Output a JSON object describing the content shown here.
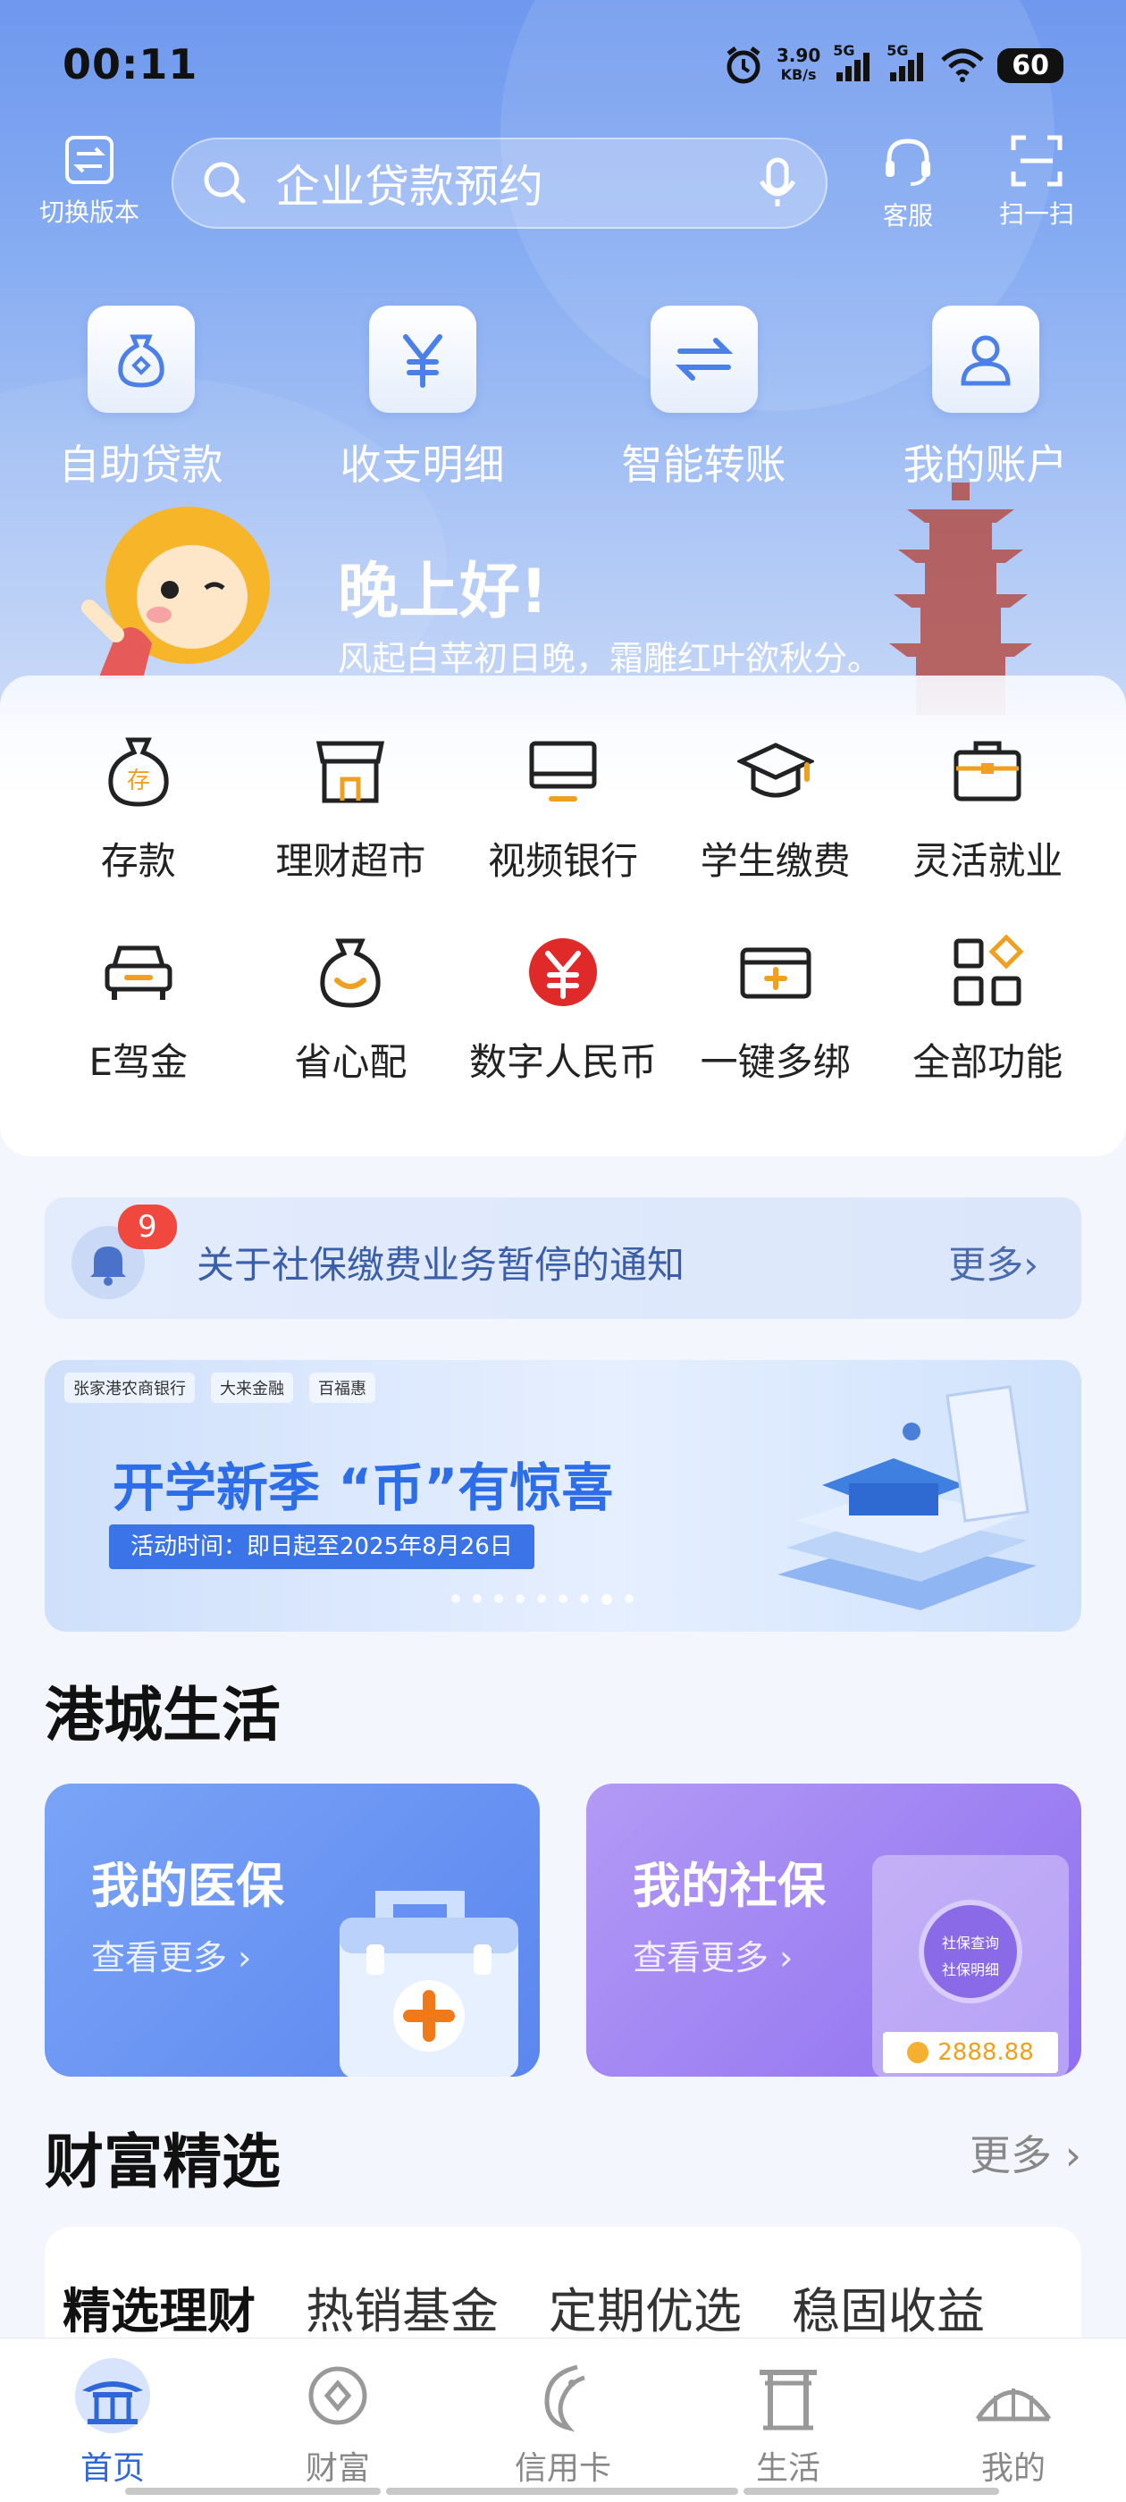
{
  "status_bar": {
    "time": "00:11",
    "speed_value": "3.90",
    "speed_unit": "KB/s",
    "net1": "5G",
    "net2": "5G",
    "battery": "60"
  },
  "top_bar": {
    "switch_version": "切换版本",
    "search_placeholder": "企业贷款预约",
    "service": "客服",
    "scan": "扫一扫"
  },
  "quick_actions": [
    {
      "label": "自助贷款",
      "icon": "money-bag-icon"
    },
    {
      "label": "收支明细",
      "icon": "yuan-icon"
    },
    {
      "label": "智能转账",
      "icon": "transfer-icon"
    },
    {
      "label": "我的账户",
      "icon": "user-icon"
    }
  ],
  "greeting": {
    "title": "晚上好!",
    "poem": "风起白苹初日晚，霜雕红叶欲秋分。"
  },
  "functions": [
    {
      "label": "存款",
      "icon": "deposit-bag-icon"
    },
    {
      "label": "理财超市",
      "icon": "store-icon"
    },
    {
      "label": "视频银行",
      "icon": "monitor-icon"
    },
    {
      "label": "学生缴费",
      "icon": "graduation-cap-icon"
    },
    {
      "label": "灵活就业",
      "icon": "briefcase-icon"
    },
    {
      "label": "E驾金",
      "icon": "car-icon"
    },
    {
      "label": "省心配",
      "icon": "smile-bag-icon"
    },
    {
      "label": "数字人民币",
      "icon": "digital-rmb-icon"
    },
    {
      "label": "一键多绑",
      "icon": "card-plus-icon"
    },
    {
      "label": "全部功能",
      "icon": "grid-icon"
    }
  ],
  "notice": {
    "badge": "9",
    "text": "关于社保缴费业务暂停的通知",
    "more": "更多›"
  },
  "banner": {
    "brand1": "张家港农商银行",
    "brand2": "大来金融",
    "brand3": "百福惠",
    "headline": "开学新季  “币”有惊喜",
    "period": "活动时间：即日起至2025年8月26日",
    "dots_total": 9,
    "dots_active": 8
  },
  "life": {
    "title": "港城生活",
    "cards": [
      {
        "title": "我的医保",
        "sub": "查看更多 ›"
      },
      {
        "title": "我的社保",
        "sub": "查看更多 ›",
        "amount": "2888.88",
        "stamp1": "社保查询",
        "stamp2": "社保明细"
      }
    ]
  },
  "wealth": {
    "title": "财富精选",
    "more": "更多 ›",
    "tabs": [
      "精选理财",
      "热销基金",
      "定期优选",
      "稳固收益"
    ]
  },
  "bottom_nav": [
    {
      "label": "首页",
      "active": true
    },
    {
      "label": "财富",
      "active": false
    },
    {
      "label": "信用卡",
      "active": false
    },
    {
      "label": "生活",
      "active": false
    },
    {
      "label": "我的",
      "active": false
    }
  ],
  "colors": {
    "brand_blue": "#2f67d8",
    "hero_top": "#6f98ee",
    "badge_red": "#f0473f",
    "accent_orange": "#f0a020",
    "rmb_red": "#e02a2a"
  }
}
